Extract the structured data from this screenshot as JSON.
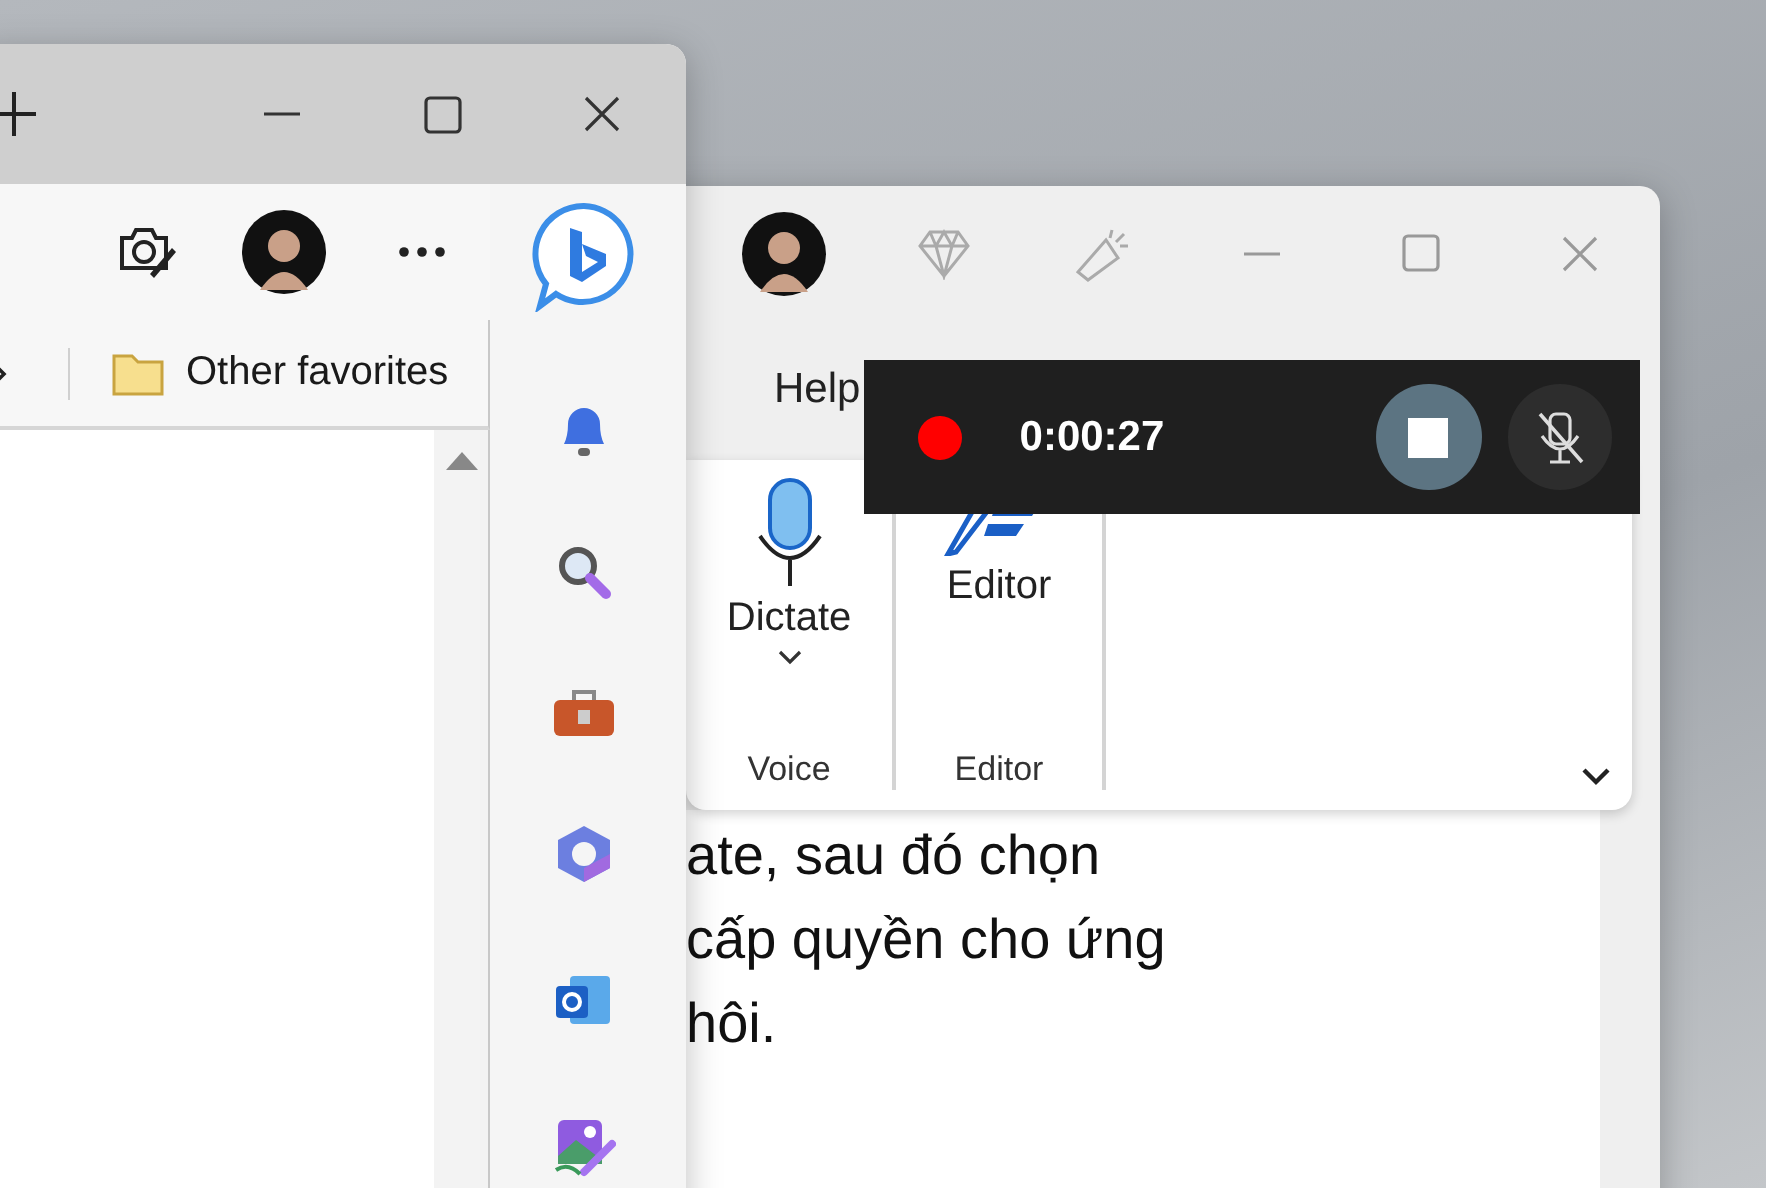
{
  "edge_window": {
    "favorites": [
      {
        "label": "Other favorites"
      }
    ]
  },
  "word_window": {
    "menu": [
      "Help"
    ],
    "ribbon_groups": [
      {
        "name": "Voice",
        "command": "Dictate",
        "dropdown": true
      },
      {
        "name": "Editor",
        "command": "Editor",
        "dropdown": false
      }
    ],
    "document_lines": [
      "ate, sau đó chọn",
      "cấp quyền cho ứng",
      "hôi."
    ]
  },
  "recorder": {
    "timer": "0:00:27",
    "recording": true,
    "mic_muted": true
  }
}
